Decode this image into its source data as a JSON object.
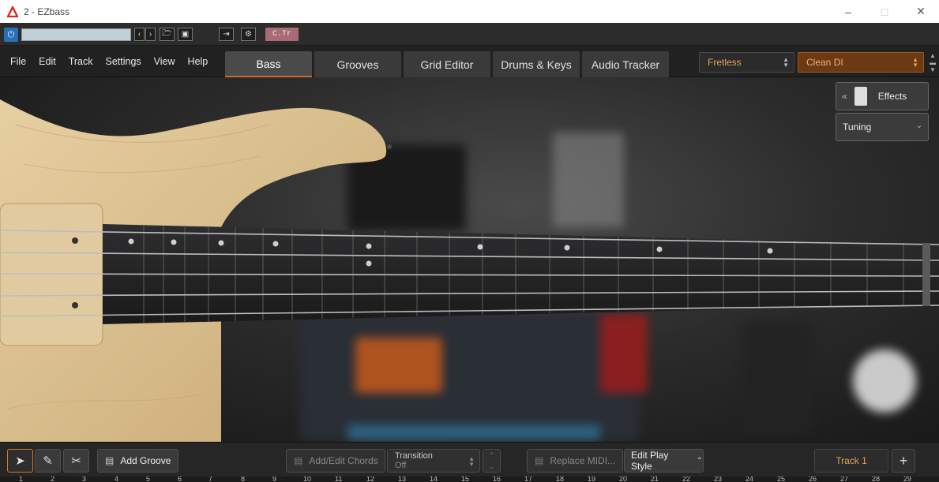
{
  "window": {
    "title": "2 - EZbass",
    "controls": [
      "minimize",
      "maximize",
      "close"
    ]
  },
  "host_toolbar": {
    "ctr_label": "C.Tr"
  },
  "menu": [
    "File",
    "Edit",
    "Track",
    "Settings",
    "View",
    "Help"
  ],
  "tabs": [
    {
      "label": "Bass",
      "active": true
    },
    {
      "label": "Grooves",
      "active": false
    },
    {
      "label": "Grid Editor",
      "active": false
    },
    {
      "label": "Drums & Keys",
      "active": false
    },
    {
      "label": "Audio Tracker",
      "active": false
    }
  ],
  "selectors": {
    "bass_model": "Fretless",
    "amp_preset": "Clean DI"
  },
  "side_panel": {
    "effects_label": "Effects",
    "tuning_label": "Tuning"
  },
  "bottom": {
    "add_groove": "Add Groove",
    "add_edit_chords": "Add/Edit Chords",
    "transition_label": "Transition",
    "transition_value": "Off",
    "replace_midi": "Replace MIDI...",
    "edit_play_style": "Edit Play Style",
    "track": "Track 1"
  },
  "ruler_numbers": [
    "1",
    "2",
    "3",
    "4",
    "5",
    "6",
    "7",
    "8",
    "9",
    "10",
    "11",
    "12",
    "13",
    "14",
    "15",
    "16",
    "17",
    "18",
    "19",
    "20",
    "21",
    "22",
    "23",
    "24",
    "25",
    "26",
    "27",
    "28",
    "29"
  ],
  "colors": {
    "accent_orange": "#e7a355",
    "active_tab_underline": "#c76a2a",
    "power_blue": "#2a6fb5"
  }
}
